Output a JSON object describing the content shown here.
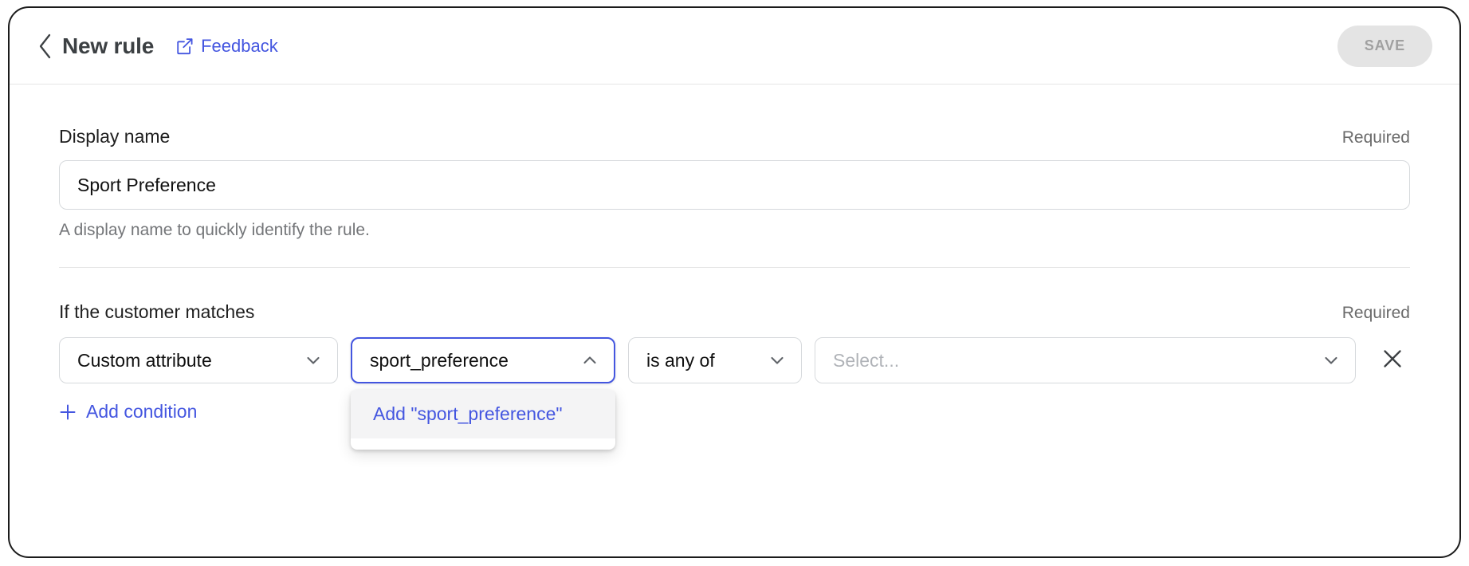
{
  "header": {
    "back_icon": "chevron-left-icon",
    "title": "New rule",
    "feedback_label": "Feedback",
    "feedback_icon": "external-link-icon",
    "save_label": "SAVE",
    "save_disabled": true
  },
  "display_name_section": {
    "label": "Display name",
    "required_label": "Required",
    "input_value": "Sport Preference",
    "input_placeholder": "",
    "helper_text": "A display name to quickly identify the rule."
  },
  "conditions_section": {
    "label": "If the customer matches",
    "required_label": "Required",
    "condition": {
      "attribute_type": "Custom attribute",
      "attribute_field_value": "sport_preference",
      "attribute_field_placeholder": "",
      "operator": "is any of",
      "value_placeholder": "Select...",
      "value": "",
      "remove_icon": "close-icon",
      "attribute_caret_icon": "chevron-down-icon",
      "field_caret_icon": "chevron-up-icon",
      "operator_caret_icon": "chevron-down-icon",
      "value_caret_icon": "chevron-down-icon"
    },
    "dropdown": {
      "items": [
        {
          "label": "Add \"sport_preference\""
        }
      ]
    },
    "add_condition_label": "Add condition",
    "add_condition_icon": "plus-icon"
  },
  "colors": {
    "accent": "#4456e0",
    "text_primary": "#1f1f1f",
    "text_secondary": "#747679",
    "border": "#d6d9dc",
    "disabled_bg": "#e4e4e4",
    "disabled_text": "#a0a0a0"
  }
}
